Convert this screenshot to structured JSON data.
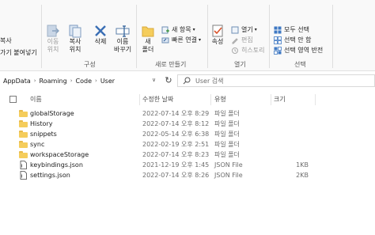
{
  "ribbon": {
    "clipboard": {
      "items": [
        "복사",
        "가기 붙여넣기"
      ]
    },
    "organize": {
      "label": "구성",
      "buttons": [
        {
          "label": "이동\n위치",
          "icon": "move-to-icon",
          "disabled": true
        },
        {
          "label": "복사\n위치",
          "icon": "copy-to-icon",
          "disabled": false
        },
        {
          "label": "삭제",
          "icon": "delete-icon",
          "disabled": false
        },
        {
          "label": "이름\n바꾸기",
          "icon": "rename-icon",
          "disabled": false
        }
      ]
    },
    "new": {
      "label": "새로 만들기",
      "new_folder": "새\n폴더",
      "new_item": "새 항목",
      "quick_access": "빠른 연결"
    },
    "open": {
      "label": "열기",
      "properties": "속성",
      "open_item": "열기",
      "edit": "편집",
      "history": "히스토리"
    },
    "select": {
      "label": "선택",
      "select_all": "모두 선택",
      "select_none": "선택 안 함",
      "invert": "선택 영역 반전"
    }
  },
  "address": {
    "crumbs": [
      "AppData",
      "Roaming",
      "Code",
      "User"
    ],
    "search_placeholder": "User 검색"
  },
  "columns": {
    "name": "이름",
    "date": "수정한 날짜",
    "type": "유형",
    "size": "크기"
  },
  "files": [
    {
      "name": "globalStorage",
      "date": "2022-07-14 오후 8:29",
      "type": "파일 폴더",
      "size": "",
      "kind": "folder"
    },
    {
      "name": "History",
      "date": "2022-07-14 오후 8:12",
      "type": "파일 폴더",
      "size": "",
      "kind": "folder"
    },
    {
      "name": "snippets",
      "date": "2022-05-14 오후 6:38",
      "type": "파일 폴더",
      "size": "",
      "kind": "folder"
    },
    {
      "name": "sync",
      "date": "2022-02-19 오후 2:51",
      "type": "파일 폴더",
      "size": "",
      "kind": "folder"
    },
    {
      "name": "workspaceStorage",
      "date": "2022-07-14 오후 8:23",
      "type": "파일 폴더",
      "size": "",
      "kind": "folder"
    },
    {
      "name": "keybindings.json",
      "date": "2021-12-19 오후 1:45",
      "type": "JSON File",
      "size": "1KB",
      "kind": "json"
    },
    {
      "name": "settings.json",
      "date": "2022-07-14 오후 8:26",
      "type": "JSON File",
      "size": "2KB",
      "kind": "json"
    }
  ],
  "colors": {
    "folder": "#f5cd5c",
    "accent": "#1a73c9",
    "delete": "#3b6fb5"
  }
}
